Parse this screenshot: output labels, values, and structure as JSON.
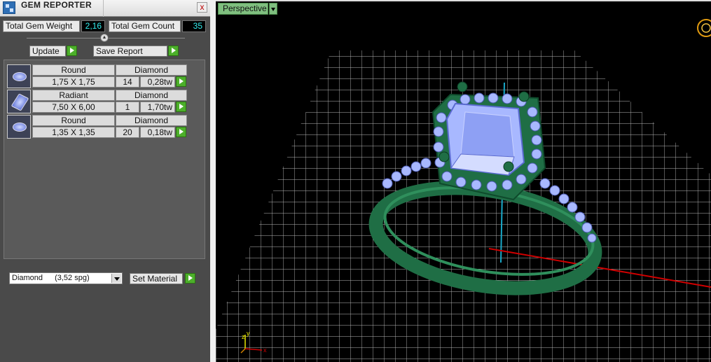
{
  "panel": {
    "title": "GEM REPORTER",
    "close_symbol": "x",
    "stats": {
      "weight_label": "Total Gem Weight",
      "weight_value": "2,16",
      "count_label": "Total Gem Count",
      "count_value": "35"
    },
    "buttons": {
      "update": "Update",
      "save_report": "Save Report",
      "set_material": "Set Material"
    },
    "gems": [
      {
        "shape": "Round",
        "material": "Diamond",
        "size": "1,75 X 1,75",
        "count": "14",
        "weight": "0,28tw",
        "icon": "round-gem-icon"
      },
      {
        "shape": "Radiant",
        "material": "Diamond",
        "size": "7,50 X 6,00",
        "count": "1",
        "weight": "1,70tw",
        "icon": "radiant-gem-icon"
      },
      {
        "shape": "Round",
        "material": "Diamond",
        "size": "1,35 X 1,35",
        "count": "20",
        "weight": "0,18tw",
        "icon": "round-gem-icon"
      }
    ],
    "material_select": {
      "name": "Diamond",
      "density": "(3,52 spg)"
    }
  },
  "viewport": {
    "mode": "Perspective",
    "axes": {
      "x": "x",
      "y": "y",
      "z": "z"
    },
    "colors": {
      "grid": "#e0e0e0",
      "metal": "#1f6e45",
      "gem": "#a8b8ff",
      "x_axis": "#d00000",
      "y_axis": "#18a8c8"
    }
  }
}
